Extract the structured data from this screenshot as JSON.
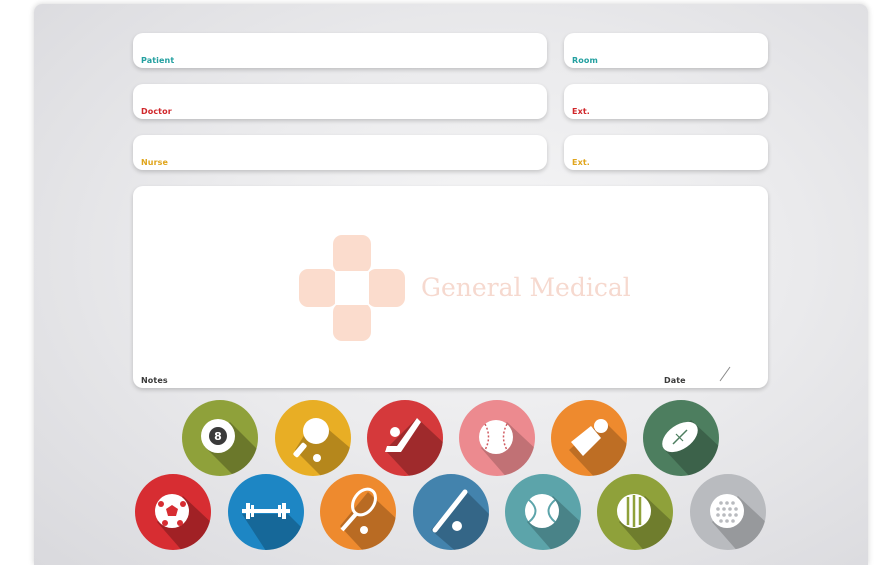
{
  "form": {
    "patient_label": "Patient",
    "room_label": "Room",
    "doctor_label": "Doctor",
    "doctor_ext_label": "Ext.",
    "nurse_label": "Nurse",
    "nurse_ext_label": "Ext.",
    "notes_label": "Notes",
    "date_label": "Date"
  },
  "watermark": {
    "text": "General Medical"
  },
  "sport_icons": [
    {
      "name": "billiard-ball-icon",
      "color": "#8fa13a"
    },
    {
      "name": "ping-pong-icon",
      "color": "#e8ae25"
    },
    {
      "name": "hockey-stick-icon",
      "color": "#d5393b"
    },
    {
      "name": "baseball-icon",
      "color": "#ec8a8f"
    },
    {
      "name": "shuttlecock-icon",
      "color": "#ee8a2e"
    },
    {
      "name": "football-icon",
      "color": "#4d7e5f"
    },
    {
      "name": "soccer-ball-icon",
      "color": "#d72d32"
    },
    {
      "name": "dumbbell-icon",
      "color": "#1d86c4"
    },
    {
      "name": "tennis-racket-icon",
      "color": "#ee8a2e"
    },
    {
      "name": "baseball-bat-icon",
      "color": "#4383ad"
    },
    {
      "name": "tennis-ball-icon",
      "color": "#5ca4aa"
    },
    {
      "name": "volleyball-icon",
      "color": "#8fa13a"
    },
    {
      "name": "golf-ball-icon",
      "color": "#b9bbbf"
    }
  ]
}
